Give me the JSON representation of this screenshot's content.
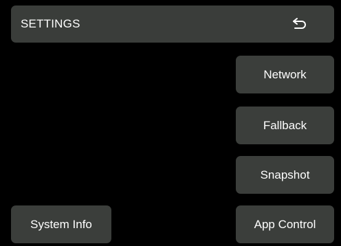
{
  "header": {
    "title": "SETTINGS",
    "back_icon": "return-arrow-icon"
  },
  "menu": {
    "network_label": "Network",
    "fallback_label": "Fallback",
    "snapshot_label": "Snapshot",
    "app_control_label": "App Control",
    "system_info_label": "System Info"
  },
  "colors": {
    "background": "#000000",
    "panel": "#3a3d3a",
    "text": "#ffffff"
  }
}
